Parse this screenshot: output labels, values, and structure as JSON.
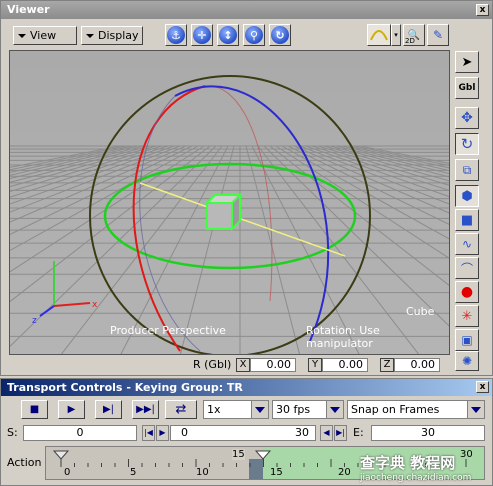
{
  "viewer": {
    "title": "Viewer",
    "close_glyph": "x",
    "menus": {
      "view": "View",
      "display": "Display"
    },
    "toolbar_icons": [
      "anchor-icon",
      "move-arrows-icon",
      "dolly-icon",
      "zoom-icon",
      "rotate-icon"
    ],
    "right_icons": {
      "curve_label": "2D"
    },
    "viewport": {
      "object_label": "Cube",
      "camera_label": "Producer Perspective",
      "mode_label": "Rotation: Use manipulator",
      "colors": {
        "grid": "#8a8a8a",
        "sphere": "#3c3c14",
        "red_ring": "#e02020",
        "green_ring": "#20c020",
        "blue_ring": "#3030c0",
        "cube": "#40ff40"
      }
    },
    "sidebar": [
      "select-arrow-icon",
      "gbl-label",
      "translate-icon",
      "rotate-manip-icon",
      "scale-icon",
      "select-object-icon",
      "cube-icon",
      "curve-icon",
      "spline-icon",
      "point-icon",
      "particle-icon",
      "camera-icon",
      "light-icon"
    ],
    "sidebar_gbl": "Gbl",
    "coords": {
      "label": "R (Gbl)",
      "x_key": "X",
      "x_val": "0.00",
      "y_key": "Y",
      "y_val": "0.00",
      "z_key": "Z",
      "z_val": "0.00"
    }
  },
  "transport": {
    "title": "Transport Controls  -  Keying Group: TR",
    "speed": "1x",
    "fps": "30 fps",
    "snap": "Snap on Frames",
    "start_label": "S:",
    "start_val": "0",
    "range_start": "0",
    "range_end": "30",
    "end_label": "E:",
    "end_val": "30",
    "action_label": "Action",
    "ruler_ticks": [
      "0",
      "5",
      "10",
      "15",
      "20"
    ],
    "marker_left": "15",
    "marker_right": "30"
  },
  "watermark": {
    "main": "查字典 教程网",
    "url": "jiaocheng.chazidian.com"
  }
}
